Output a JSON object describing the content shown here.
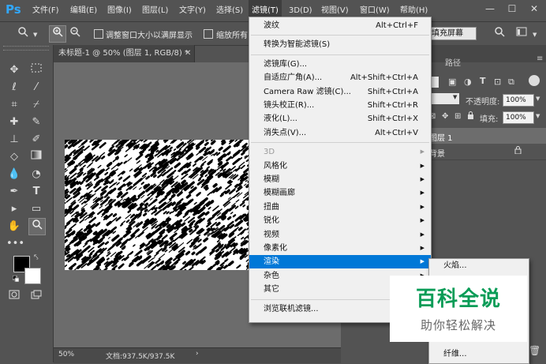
{
  "app": {
    "logo": "Ps"
  },
  "menubar": {
    "items": [
      "文件(F)",
      "编辑(E)",
      "图像(I)",
      "图层(L)",
      "文字(Y)",
      "选择(S)",
      "滤镜(T)",
      "3D(D)",
      "视图(V)",
      "窗口(W)",
      "帮助(H)"
    ],
    "active": "滤镜(T)"
  },
  "window_controls": {
    "minimize": "—",
    "maximize": "☐",
    "close": "✕"
  },
  "options": {
    "resize_windows": "调整窗口大小以满屏显示",
    "zoom_all": "缩放所有",
    "fill_screen": "填充屏幕"
  },
  "document": {
    "tab_title": "未标题-1 @ 50% (图层 1, RGB/8) *",
    "zoom": "50%",
    "doc_info": "文档:937.5K/937.5K"
  },
  "panels": {
    "tab_paths": "路径",
    "opacity_label": "不透明度:",
    "opacity_value": "100%",
    "fill_label": "填充:",
    "fill_value": "100%",
    "layers": [
      {
        "name": "图层 1",
        "selected": true
      },
      {
        "name": "背景",
        "selected": false
      }
    ]
  },
  "filter_menu": {
    "items": [
      {
        "label": "波纹",
        "shortcut": "Alt+Ctrl+F"
      },
      {
        "sep": true
      },
      {
        "label": "转换为智能滤镜(S)"
      },
      {
        "sep": true
      },
      {
        "label": "滤镜库(G)..."
      },
      {
        "label": "自适应广角(A)...",
        "shortcut": "Alt+Shift+Ctrl+A"
      },
      {
        "label": "Camera Raw 滤镜(C)...",
        "shortcut": "Shift+Ctrl+A"
      },
      {
        "label": "镜头校正(R)...",
        "shortcut": "Shift+Ctrl+R"
      },
      {
        "label": "液化(L)...",
        "shortcut": "Shift+Ctrl+X"
      },
      {
        "label": "消失点(V)...",
        "shortcut": "Alt+Ctrl+V"
      },
      {
        "sep": true
      },
      {
        "label": "3D",
        "submenu": true,
        "disabled": true
      },
      {
        "label": "风格化",
        "submenu": true
      },
      {
        "label": "模糊",
        "submenu": true
      },
      {
        "label": "模糊画廊",
        "submenu": true
      },
      {
        "label": "扭曲",
        "submenu": true
      },
      {
        "label": "锐化",
        "submenu": true
      },
      {
        "label": "视频",
        "submenu": true
      },
      {
        "label": "像素化",
        "submenu": true
      },
      {
        "label": "渲染",
        "submenu": true,
        "highlighted": true
      },
      {
        "label": "杂色",
        "submenu": true
      },
      {
        "label": "其它",
        "submenu": true
      },
      {
        "sep": true
      },
      {
        "label": "浏览联机滤镜..."
      }
    ]
  },
  "render_submenu": {
    "items": [
      "火焰...",
      "纤维..."
    ]
  },
  "watermark": {
    "title": "百科全说",
    "subtitle": "助你轻松解决"
  },
  "colors": {
    "accent": "#0078d7",
    "ps_blue": "#31a8ff",
    "watermark_green": "#0a9c57"
  }
}
